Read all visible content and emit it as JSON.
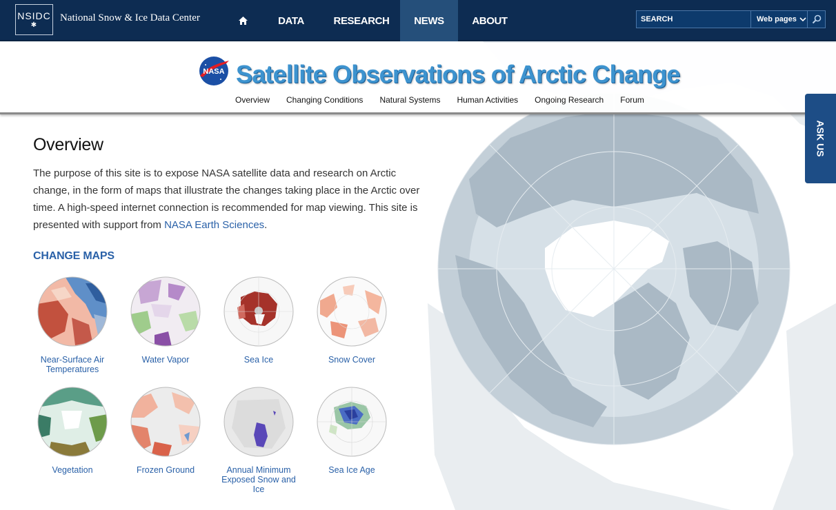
{
  "topbar": {
    "logo_text": "NSIDC",
    "org_name": "National Snow & Ice Data Center",
    "nav": [
      {
        "label": "",
        "icon": "home-icon"
      },
      {
        "label": "DATA"
      },
      {
        "label": "RESEARCH"
      },
      {
        "label": "NEWS",
        "active": true
      },
      {
        "label": "ABOUT"
      }
    ],
    "search": {
      "placeholder": "SEARCH",
      "scope_selected": "Web pages"
    }
  },
  "header": {
    "title": "Satellite Observations of Arctic Change",
    "subnav": [
      "Overview",
      "Changing Conditions",
      "Natural Systems",
      "Human Activities",
      "Ongoing Research",
      "Forum"
    ]
  },
  "ask_us": "ASK US",
  "content": {
    "heading": "Overview",
    "intro_text": "The purpose of this site is to expose NASA satellite data and research on Arctic change, in the form of maps that illustrate the changes taking place in the Arctic over time. A high-speed internet connection is recommended for map viewing. This site is presented with support from ",
    "intro_link": "NASA Earth Sciences",
    "intro_end": ".",
    "change_maps_heading": "CHANGE MAPS",
    "maps": [
      {
        "label": "Near-Surface Air Temperatures"
      },
      {
        "label": "Water Vapor"
      },
      {
        "label": "Sea Ice"
      },
      {
        "label": "Snow Cover"
      },
      {
        "label": "Vegetation"
      },
      {
        "label": "Frozen Ground"
      },
      {
        "label": "Annual Minimum Exposed Snow and Ice"
      },
      {
        "label": "Sea Ice Age"
      }
    ]
  },
  "colors": {
    "topbar": "#0d2c52",
    "nav_active": "#254f7a",
    "title_blue": "#3d93cf",
    "link_blue": "#2a61a8",
    "ask_us": "#1d4d86"
  }
}
